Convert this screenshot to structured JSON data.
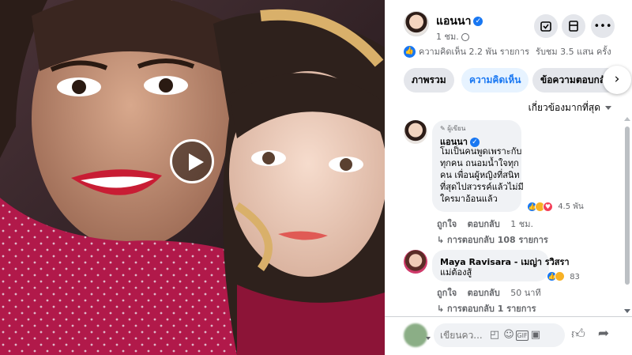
{
  "post": {
    "author": "แอนนา",
    "time": "1 ชม.",
    "stats": {
      "comments_text": "ความคิดเห็น 2.2 พัน รายการ",
      "views_text": "รับชม 3.5 แสน ครั้ง"
    }
  },
  "tabs": [
    {
      "label": "ภาพรวม",
      "active": false
    },
    {
      "label": "ความคิดเห็น",
      "active": true
    },
    {
      "label": "ข้อความตอบกลับ",
      "active": false
    }
  ],
  "sort_label": "เกี่ยวข้องมากที่สุด",
  "comments": [
    {
      "badge": "ผู้เขียน",
      "author": "แอนนา",
      "text": "โมเป็นคนพูดเพราะกับ\nทุกคน ถนอมน้ำใจทุก\nคน เพื่อนผู้หญิงที่สนิท\nที่สุดไปสวรรค์แล้วไม่มี\nใครมาอ้อนแล้ว",
      "reactions": "4.5 พัน",
      "reply_action": "ตอบกลับ",
      "like_action": "ถูกใจ",
      "time": "1 ชม.",
      "replies": "การตอบกลับ 108 รายการ"
    },
    {
      "author": "Maya Ravisara - เมญ่า รวิสรา",
      "text": "แม่ต้องสู้",
      "reactions": "83",
      "reply_action": "ตอบกลับ",
      "like_action": "ถูกใจ",
      "time": "50 นาที",
      "replies": "การตอบกลับ 1 รายการ"
    }
  ],
  "composer": {
    "placeholder": "เขียนคว..."
  },
  "colors": {
    "accent": "#1877f2",
    "bubble": "#f0f2f5",
    "muted": "#65676b"
  },
  "icons": [
    "play-icon",
    "save-icon",
    "bookmark-icon",
    "more-icon",
    "globe-icon",
    "like-reaction-icon",
    "sad-reaction-icon",
    "love-reaction-icon",
    "sticker-icon",
    "emoji-icon",
    "gif-icon",
    "camera-icon",
    "thumbs-up-icon",
    "share-icon",
    "chevron-right-icon",
    "chevron-down-icon",
    "verified-icon",
    "pencil-icon"
  ]
}
